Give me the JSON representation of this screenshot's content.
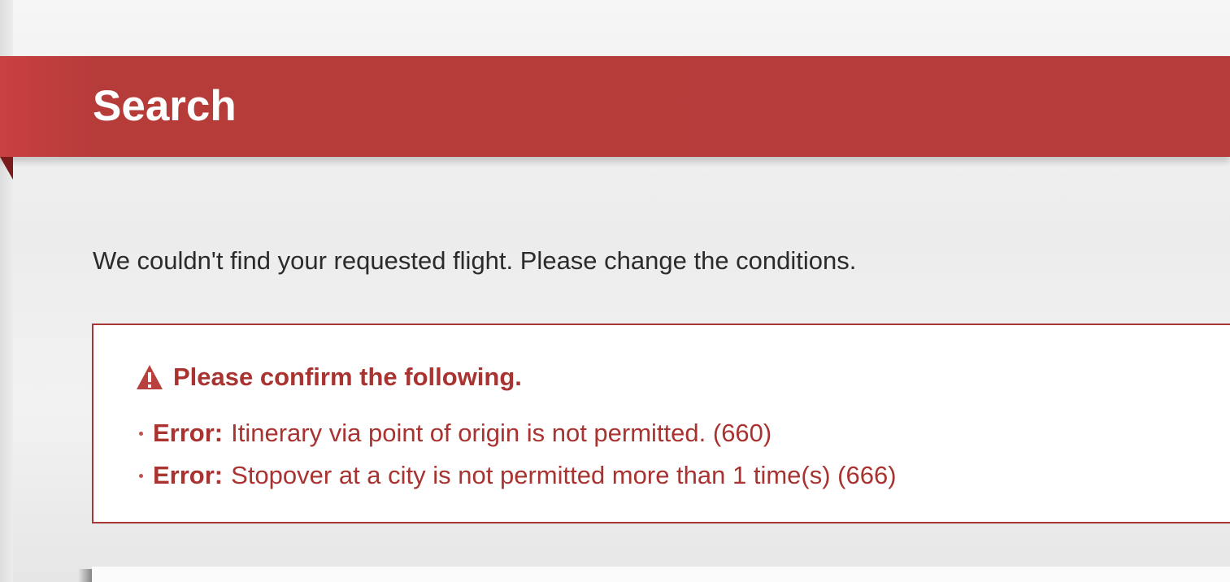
{
  "banner": {
    "title": "Search"
  },
  "message": "We couldn't find your requested flight. Please change the conditions.",
  "alert": {
    "icon": "warning-triangle-icon",
    "heading": "Please confirm the following.",
    "errors": [
      {
        "label": "Error:",
        "text": "Itinerary via point of origin is not permitted. (660)"
      },
      {
        "label": "Error:",
        "text": "Stopover at a city is not permitted more than 1 time(s) (666)"
      }
    ]
  },
  "colors": {
    "banner": "#b53c3b",
    "alert_text": "#a93330",
    "alert_border": "#a83634",
    "body_text": "#2b2b2b"
  }
}
